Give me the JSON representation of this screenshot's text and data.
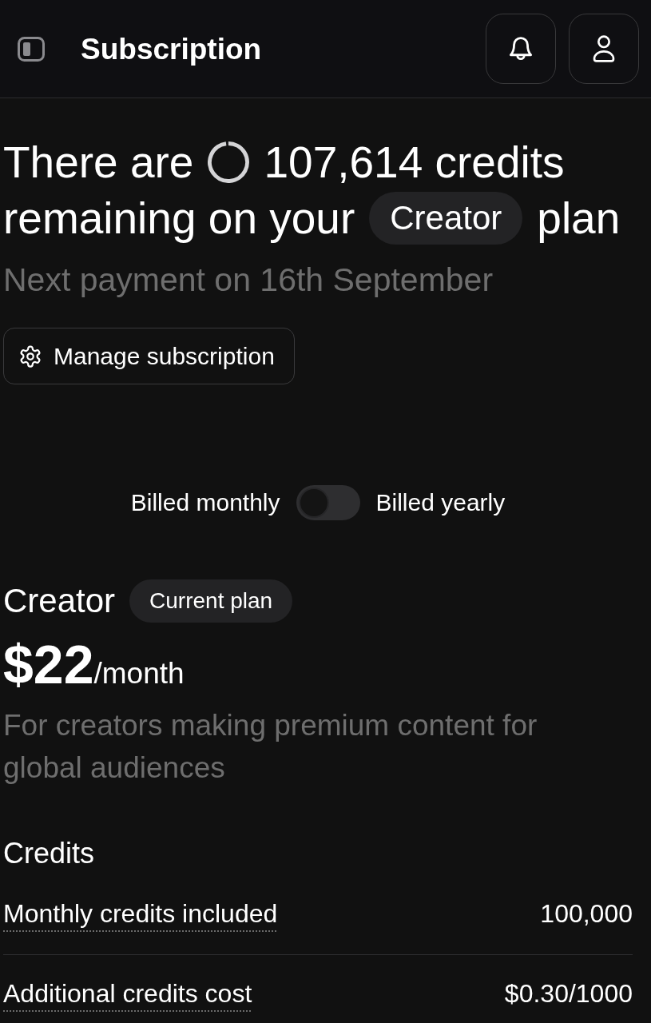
{
  "header": {
    "title": "Subscription"
  },
  "headline": [
    {
      "parts": [
        {
          "kind": "text",
          "text": "There are"
        },
        {
          "kind": "ring",
          "level": 0.98
        },
        {
          "kind": "text",
          "text": "107,614 credits"
        }
      ]
    },
    {
      "parts": [
        {
          "kind": "text",
          "text": "remaining on your"
        },
        {
          "kind": "badge",
          "text": "Creator"
        },
        {
          "kind": "text",
          "text": "plan"
        }
      ]
    }
  ],
  "next_payment": "Next payment on 16th September",
  "manage_button": {
    "label": "Manage subscription"
  },
  "billing": {
    "left_label": "Billed monthly",
    "right_label": "Billed yearly",
    "on": false
  },
  "plan": {
    "name": "Creator",
    "badge": "Current plan",
    "price": "$22",
    "period": "/month",
    "description": "For creators making premium content for global audiences"
  },
  "credits": {
    "title": "Credits",
    "rows": [
      {
        "label": "Monthly credits included",
        "value": "100,000"
      },
      {
        "label": "Additional credits cost",
        "value": "$0.30/1000"
      }
    ]
  }
}
